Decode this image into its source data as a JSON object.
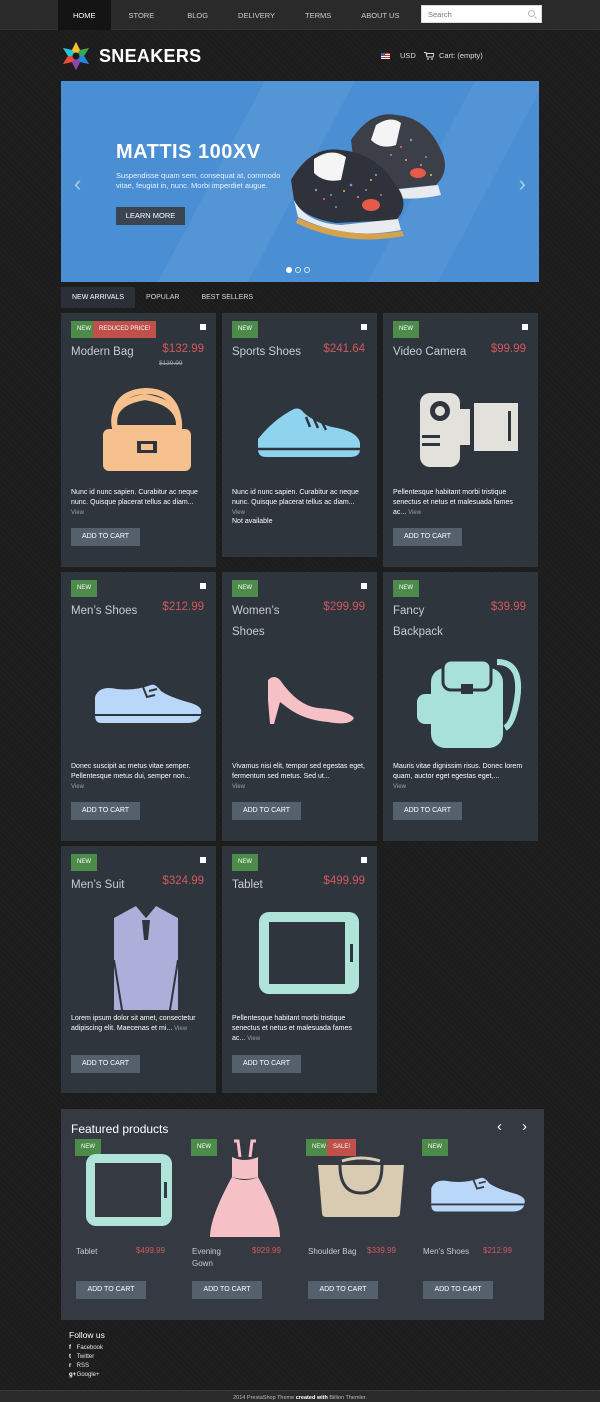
{
  "nav": {
    "items": [
      "HOME",
      "STORE",
      "BLOG",
      "DELIVERY",
      "TERMS",
      "ABOUT US"
    ],
    "search_placeholder": "Search"
  },
  "header": {
    "brand": "SNEAKERS",
    "currency": "USD",
    "cart": "Cart: (empty)"
  },
  "slider": {
    "title": "MATTIS 100XV",
    "text": "Suspendisse quam sem, consequat at, commodo vitae, feugiat in, nunc. Morbi imperdiet augue.",
    "button": "LEARN MORE",
    "prev": "‹",
    "next": "›",
    "active_dot": 1,
    "dot_count": 3
  },
  "tabs": [
    "NEW ARRIVALS",
    "POPULAR",
    "BEST SELLERS"
  ],
  "products": [
    {
      "name": "Modern Bag",
      "price": "$132.99",
      "old_price": "$139.99",
      "badges": [
        "NEW",
        "REDUCED PRICE!"
      ],
      "desc": "Nunc id nunc sapien. Curabitur ac neque nunc. Quisque placerat tellus ac diam...",
      "view": "View",
      "button": "ADD TO CART",
      "icon": "bag-icon",
      "color": "#f7c08f"
    },
    {
      "name": "Sports Shoes",
      "price": "$241.64",
      "badges": [
        "NEW"
      ],
      "desc": "Nunc id nunc sapien. Curabitur ac neque nunc. Quisque placerat tellus ac diam...",
      "view": "View",
      "availability": "Not available",
      "icon": "sneaker-icon",
      "color": "#8fd4ef"
    },
    {
      "name": "Video Camera",
      "price": "$99.99",
      "badges": [
        "NEW"
      ],
      "desc": "Pellentesque habitant morbi tristique senectus et netus et malesuada fames ac...",
      "view": "View",
      "button": "ADD TO CART",
      "icon": "camera-icon",
      "color": "#e3e1dc"
    },
    {
      "name": "Men’s Shoes",
      "price": "$212.99",
      "badges": [
        "NEW"
      ],
      "desc": "Donec suscipit ac metus vitae semper. Pellentesque metus dui, semper non...",
      "view": "View",
      "button": "ADD TO CART",
      "icon": "shoe-icon",
      "color": "#b9d7f8"
    },
    {
      "name": "Women’s Shoes",
      "price": "$299.99",
      "badges": [
        "NEW"
      ],
      "desc": "Vivamus nisi elit, tempor sed egestas eget, fermentum sed metus. Sed ut...",
      "view": "View",
      "button": "ADD TO CART",
      "icon": "heel-icon",
      "color": "#f6c1c6"
    },
    {
      "name": "Fancy Backpack",
      "price": "$39.99",
      "badges": [
        "NEW"
      ],
      "desc": "Mauris vitae dignissim risus. Donec lorem quam, auctor eget egestas eget,...",
      "view": "View",
      "button": "ADD TO CART",
      "icon": "backpack-icon",
      "color": "#a8e1d9"
    },
    {
      "name": "Men’s Suit",
      "price": "$324.99",
      "badges": [
        "NEW"
      ],
      "desc": "Lorem ipsum dolor sit amet, consectetur adipiscing elit. Maecenas et mi...",
      "view": "View",
      "button": "ADD TO CART",
      "icon": "suit-icon",
      "color": "#adaed9"
    },
    {
      "name": "Tablet",
      "price": "$499.99",
      "badges": [
        "NEW"
      ],
      "desc": "Pellentesque habitant morbi tristique senectus et netus et malesuada fames ac...",
      "view": "View",
      "button": "ADD TO CART",
      "icon": "tablet-icon",
      "color": "#b1e4d8"
    }
  ],
  "featured": {
    "title": "Featured products",
    "prev": "‹",
    "next": "›",
    "items": [
      {
        "name": "Tablet",
        "price": "$499.99",
        "badges": [
          "NEW"
        ],
        "button": "ADD TO CART",
        "icon": "tablet-icon"
      },
      {
        "name": "Evening Gown",
        "price": "$929.99",
        "badges": [
          "NEW"
        ],
        "button": "ADD TO CART",
        "icon": "dress-icon"
      },
      {
        "name": "Shoulder Bag",
        "price": "$339.99",
        "badges": [
          "NEW",
          "SALE!"
        ],
        "button": "ADD TO CART",
        "icon": "shoulder-bag-icon"
      },
      {
        "name": "Men’s Shoes",
        "price": "$212.99",
        "badges": [
          "NEW"
        ],
        "button": "ADD TO CART",
        "icon": "shoe-icon"
      }
    ]
  },
  "follow": {
    "title": "Follow us",
    "links": [
      {
        "icon": "f",
        "label": "Facebook"
      },
      {
        "icon": "t",
        "label": "Twitter"
      },
      {
        "icon": "r",
        "label": "RSS"
      },
      {
        "icon": "g+",
        "label": "Google+"
      }
    ]
  },
  "footer": {
    "year": "2014",
    "theme": "PrestaShop Theme",
    "created": "created with",
    "author": "Billion Themler."
  }
}
